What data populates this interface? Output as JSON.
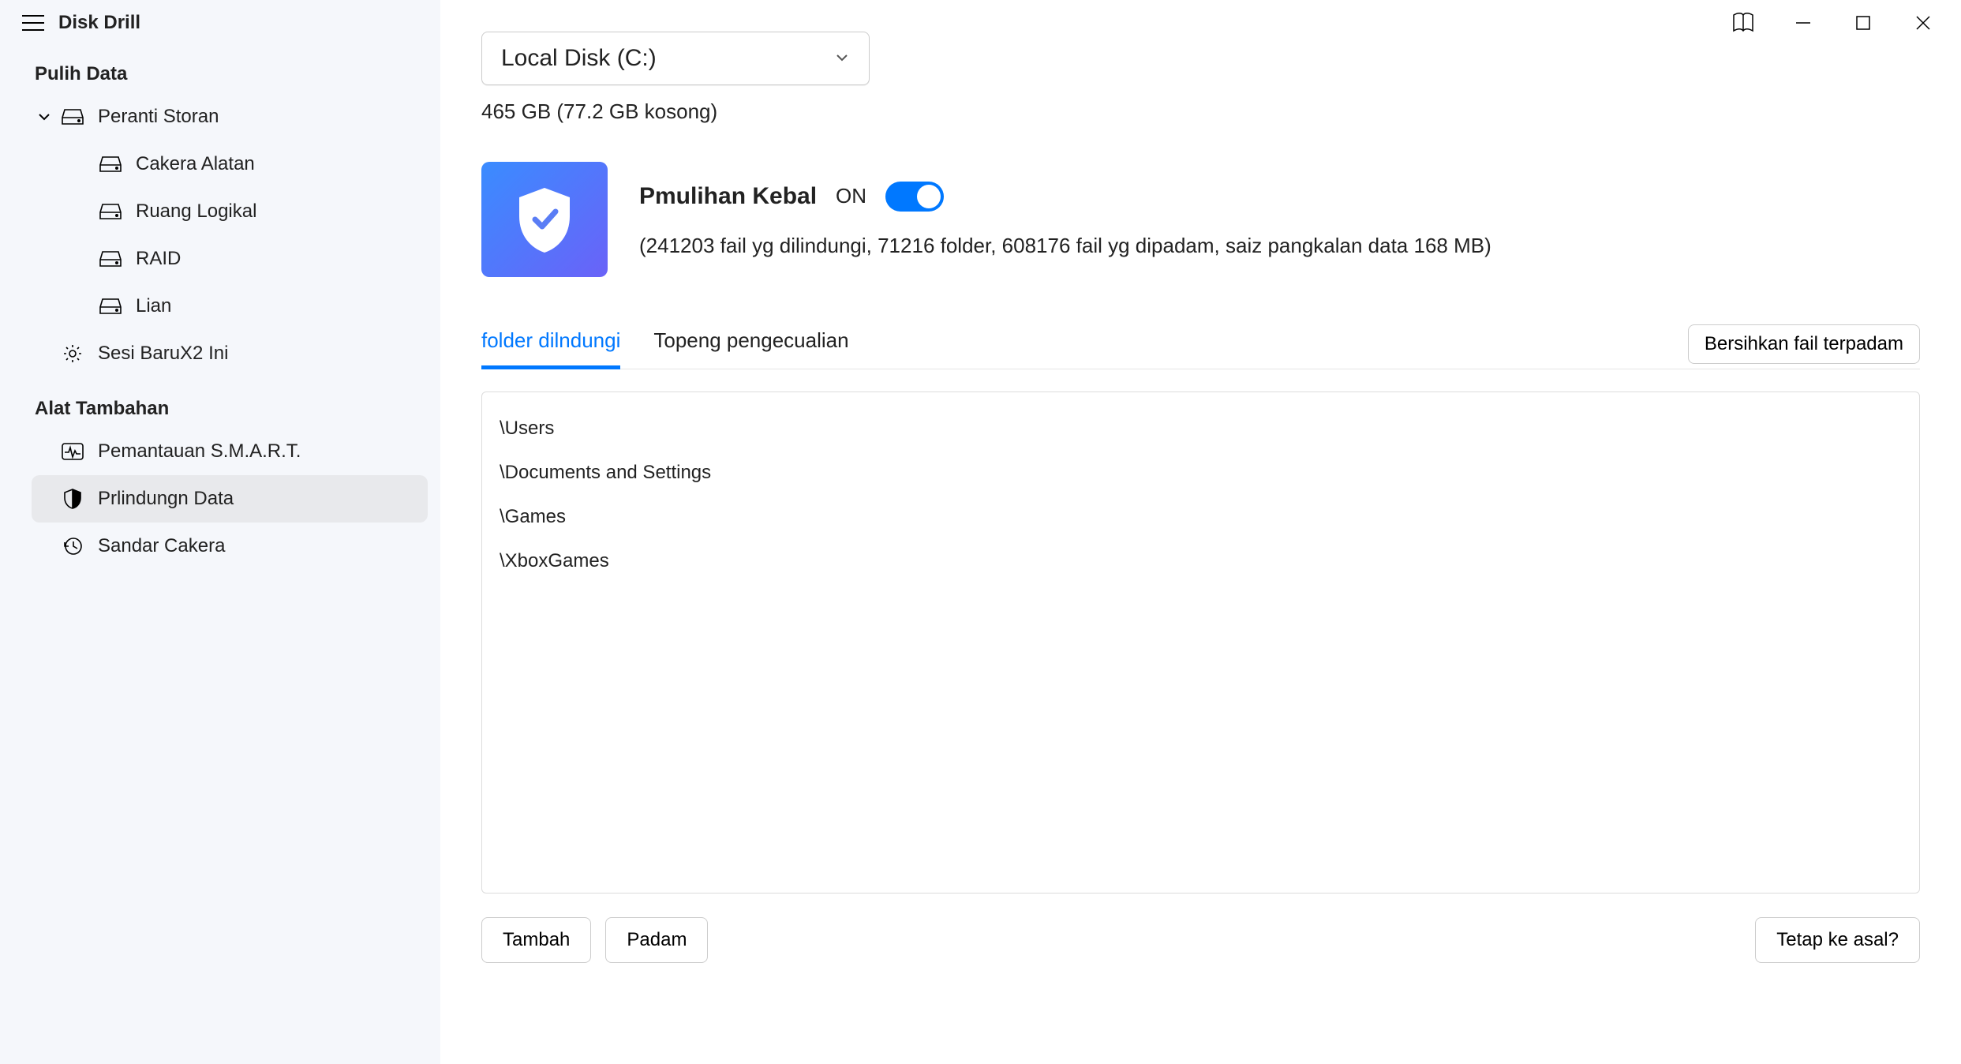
{
  "app": {
    "title": "Disk Drill"
  },
  "titlebar_icons": {
    "book": "book-icon",
    "minimize": "minimize-icon",
    "maximize": "maximize-icon",
    "close": "close-icon"
  },
  "sidebar": {
    "sections": {
      "recover": {
        "title": "Pulih Data",
        "storage_devices": {
          "label": "Peranti Storan"
        },
        "children": [
          {
            "label": "Cakera Alatan"
          },
          {
            "label": "Ruang Logikal"
          },
          {
            "label": "RAID"
          },
          {
            "label": "Lian"
          }
        ],
        "recent_sessions": {
          "label": "Sesi BaruX2 Ini"
        }
      },
      "tools": {
        "title": "Alat Tambahan",
        "items": [
          {
            "label": "Pemantauan S.M.A.R.T."
          },
          {
            "label": "Prlindungn Data",
            "selected": true
          },
          {
            "label": "Sandar Cakera"
          }
        ]
      }
    }
  },
  "main": {
    "disk_select": {
      "label": "Local Disk (C:)"
    },
    "capacity_line": "465 GB (77.2 GB kosong)",
    "protection": {
      "title": "Pmulihan Kebal",
      "state": "ON",
      "toggle_on": true,
      "stats": "(241203 fail yg dilindungi, 71216 folder, 608176 fail yg dipadam, saiz pangkalan data 168 MB)"
    },
    "tabs": [
      {
        "label": "folder dilndungi",
        "active": true
      },
      {
        "label": "Topeng pengecualian",
        "active": false
      }
    ],
    "tabs_action": "Bersihkan fail terpadam",
    "folders": [
      "\\Users",
      "\\Documents and Settings",
      "\\Games",
      "\\XboxGames"
    ],
    "footer": {
      "add": "Tambah",
      "delete": "Padam",
      "reset": "Tetap ke asal?"
    }
  }
}
